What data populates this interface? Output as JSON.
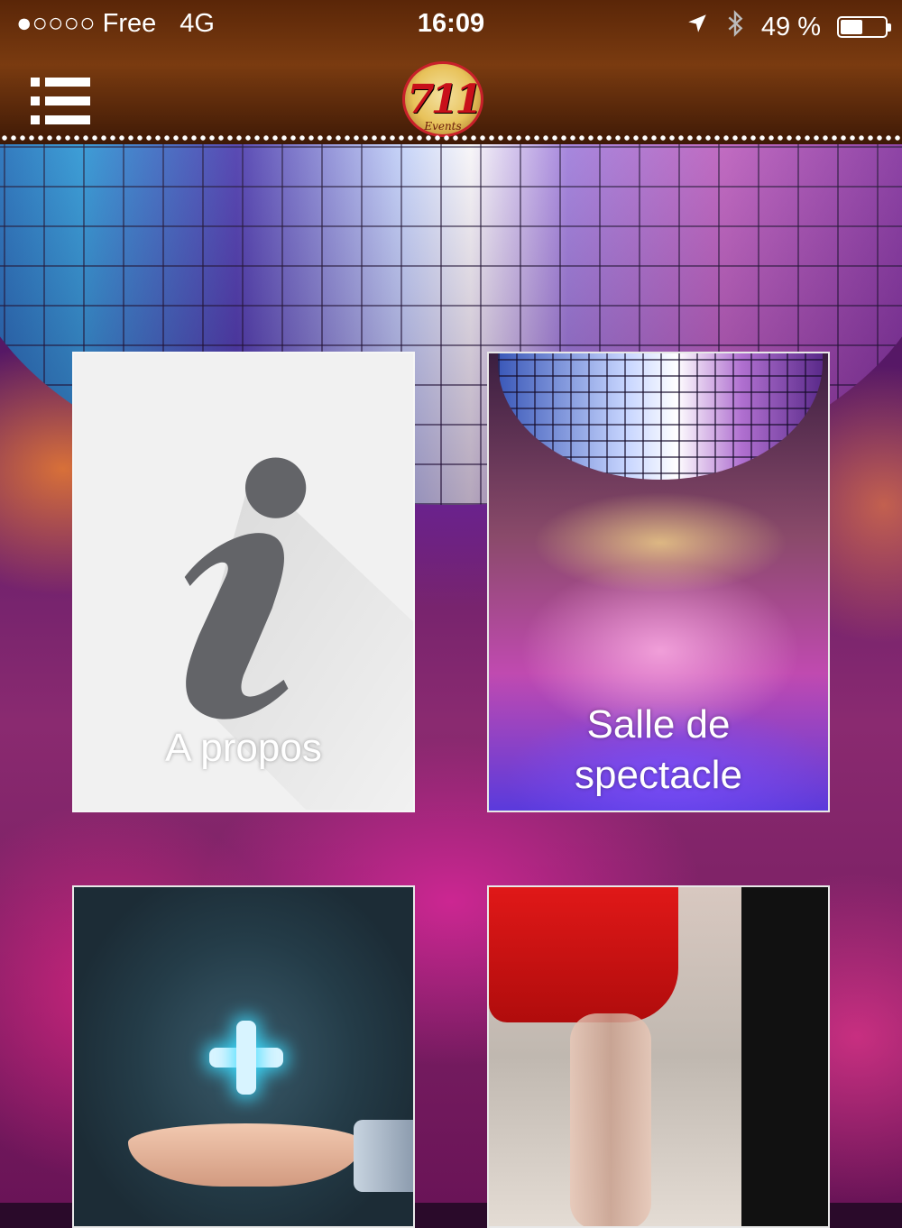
{
  "status_bar": {
    "carrier": "●○○○○ Free",
    "network": "4G",
    "time": "16:09",
    "location_icon": "location-arrow-icon",
    "bluetooth_icon": "bluetooth-icon",
    "battery_percent_text": "49 %",
    "battery_level": 0.49
  },
  "header": {
    "menu_icon": "hamburger-menu-icon",
    "logo_number": "711",
    "logo_subtitle": "Events"
  },
  "tiles": [
    {
      "id": "apropos",
      "label": "A propos",
      "icon": "info-icon"
    },
    {
      "id": "salle",
      "label": "Salle de spectacle",
      "line1": "Salle de",
      "line2": "spectacle"
    },
    {
      "id": "plus",
      "label": "",
      "icon": "plus-icon"
    },
    {
      "id": "danse",
      "label": ""
    }
  ],
  "colors": {
    "header_brown": "#5a2608",
    "tile_light": "#f1f1f1",
    "info_icon": "#636468",
    "plus_glow": "#3cdcff",
    "skirt_red": "#e01818"
  }
}
